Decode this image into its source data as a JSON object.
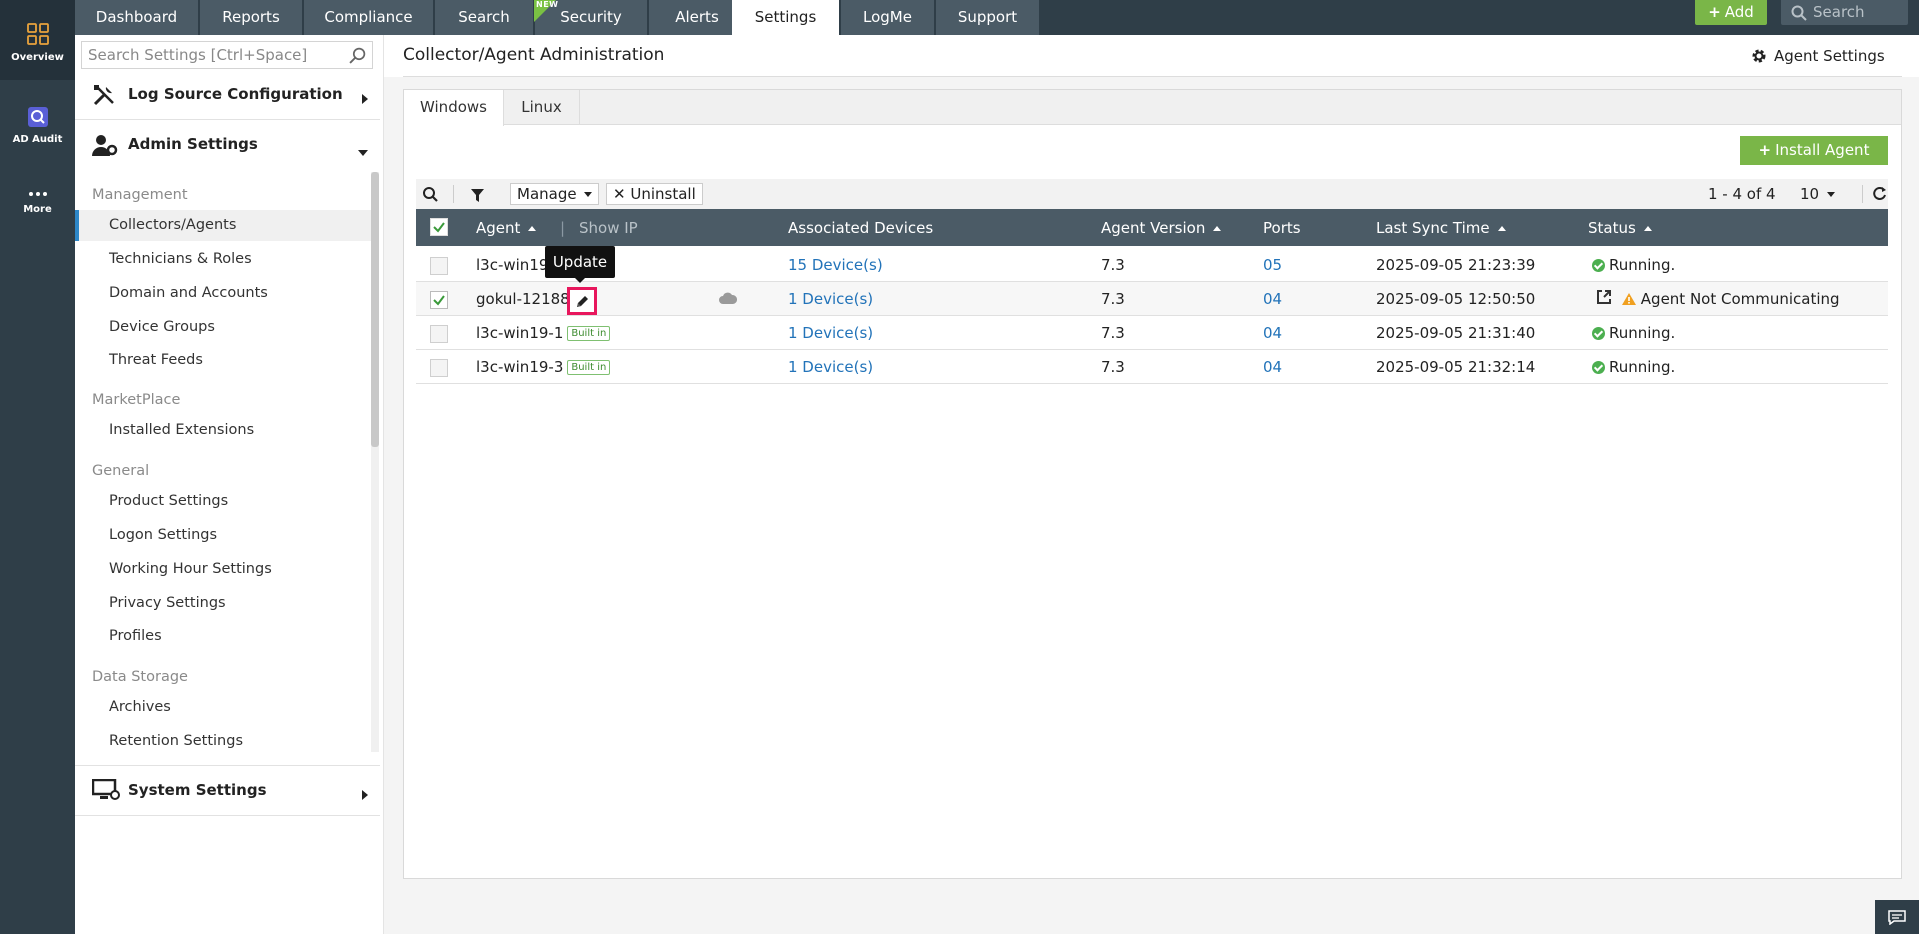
{
  "rail": {
    "items": [
      {
        "label": "Overview",
        "icon": "overview-grid-icon"
      },
      {
        "label": "AD Audit",
        "icon": "ad-audit-icon"
      },
      {
        "label": "More",
        "icon": "more-dots-icon"
      }
    ]
  },
  "topnav": {
    "tabs": [
      "Dashboard",
      "Reports",
      "Compliance",
      "Search",
      "Security",
      "Alerts",
      "Settings",
      "LogMe",
      "Support"
    ],
    "active_tab": "Settings",
    "new_badge": "NEW",
    "add_label": "Add",
    "search_placeholder": "Search"
  },
  "sidebar": {
    "search_placeholder": "Search Settings [Ctrl+Space]",
    "sections": {
      "log_source": "Log Source Configuration",
      "admin": "Admin Settings",
      "system": "System Settings"
    },
    "groups": {
      "management": "Management",
      "marketplace": "MarketPlace",
      "general": "General",
      "data_storage": "Data Storage"
    },
    "items": {
      "collectors": "Collectors/Agents",
      "technicians": "Technicians & Roles",
      "domain": "Domain and Accounts",
      "device_groups": "Device Groups",
      "threat_feeds": "Threat Feeds",
      "installed_ext": "Installed Extensions",
      "product_settings": "Product Settings",
      "logon_settings": "Logon Settings",
      "working_hour": "Working Hour Settings",
      "privacy": "Privacy Settings",
      "profiles": "Profiles",
      "archives": "Archives",
      "retention": "Retention Settings"
    }
  },
  "main": {
    "title": "Collector/Agent Administration",
    "agent_settings": "Agent Settings",
    "subtabs": [
      "Windows",
      "Linux"
    ],
    "install_agent": "Install Agent",
    "toolbar": {
      "manage": "Manage",
      "uninstall": "Uninstall",
      "pager": "1 - 4 of 4",
      "per_page": "10"
    },
    "columns": {
      "agent": "Agent",
      "show_ip": "Show IP",
      "devices": "Associated Devices",
      "version": "Agent Version",
      "ports": "Ports",
      "last_sync": "Last Sync Time",
      "status": "Status"
    },
    "tooltip": "Update",
    "rows": [
      {
        "agent": "l3c-win19-",
        "builtin": "",
        "devices": "15 Device(s)",
        "version": "7.3",
        "ports": "05",
        "last_sync": "2025-09-05 21:23:39",
        "status": "Running.",
        "checked": false
      },
      {
        "agent": "gokul-12188",
        "builtin": "",
        "devices": "1 Device(s)",
        "version": "7.3",
        "ports": "04",
        "last_sync": "2025-09-05 12:50:50",
        "status": "Agent Not Communicating",
        "checked": true
      },
      {
        "agent": "l3c-win19-1",
        "builtin": "Built in",
        "devices": "1 Device(s)",
        "version": "7.3",
        "ports": "04",
        "last_sync": "2025-09-05 21:31:40",
        "status": "Running.",
        "checked": false
      },
      {
        "agent": "l3c-win19-3",
        "builtin": "Built in",
        "devices": "1 Device(s)",
        "version": "7.3",
        "ports": "04",
        "last_sync": "2025-09-05 21:32:14",
        "status": "Running.",
        "checked": false
      }
    ]
  },
  "colors": {
    "nav_bg": "#2f3e48",
    "tab_bg": "#4b5b66",
    "accent_green": "#7ab648",
    "link_blue": "#2273b9",
    "highlight_pink": "#e8175d"
  }
}
